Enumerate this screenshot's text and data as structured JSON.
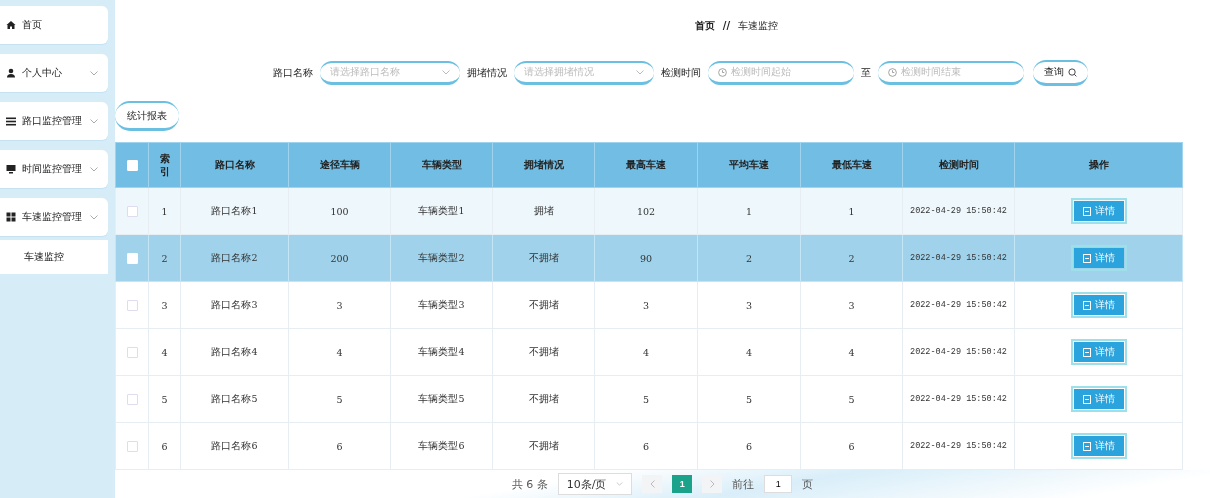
{
  "sidebar": {
    "items": [
      {
        "label": "首页",
        "expandable": false,
        "selected": false
      },
      {
        "label": "个人中心",
        "expandable": true,
        "selected": false
      },
      {
        "label": "路口监控管理",
        "expandable": true,
        "selected": false
      },
      {
        "label": "时间监控管理",
        "expandable": true,
        "selected": false
      },
      {
        "label": "车速监控管理",
        "expandable": true,
        "selected": false,
        "children": [
          {
            "label": "车速监控",
            "selected": true
          }
        ]
      }
    ]
  },
  "breadcrumb": {
    "home": "首页",
    "separator": "//",
    "current": "车速监控"
  },
  "filters": {
    "fields": [
      {
        "kind": "select",
        "label": "路口名称",
        "placeholder": "请选择路口名称"
      },
      {
        "kind": "select",
        "label": "拥堵情况",
        "placeholder": "请选择拥堵情况"
      },
      {
        "kind": "date",
        "label": "检测时间",
        "placeholder": "检测时间起始"
      },
      {
        "kind": "date",
        "label": "至",
        "placeholder": "检测时间结束"
      }
    ],
    "search_button": "查询"
  },
  "report_button": "统计报表",
  "table": {
    "select_all_checked": false,
    "columns": [
      "索引",
      "路口名称",
      "途径车辆",
      "车辆类型",
      "拥堵情况",
      "最高车速",
      "平均车速",
      "最低车速",
      "检测时间",
      "操作"
    ],
    "rows": [
      {
        "selected": false,
        "cells": [
          "1",
          "路口名称1",
          "100",
          "车辆类型1",
          "拥堵",
          "102",
          "1",
          "1",
          "2022-04-29 15:50:42"
        ],
        "action": "详情"
      },
      {
        "selected": true,
        "cells": [
          "2",
          "路口名称2",
          "200",
          "车辆类型2",
          "不拥堵",
          "90",
          "2",
          "2",
          "2022-04-29 15:50:42"
        ],
        "action": "详情"
      },
      {
        "selected": false,
        "cells": [
          "3",
          "路口名称3",
          "3",
          "车辆类型3",
          "不拥堵",
          "3",
          "3",
          "3",
          "2022-04-29 15:50:42"
        ],
        "action": "详情"
      },
      {
        "selected": false,
        "cells": [
          "4",
          "路口名称4",
          "4",
          "车辆类型4",
          "不拥堵",
          "4",
          "4",
          "4",
          "2022-04-29 15:50:42"
        ],
        "action": "详情"
      },
      {
        "selected": false,
        "cells": [
          "5",
          "路口名称5",
          "5",
          "车辆类型5",
          "不拥堵",
          "5",
          "5",
          "5",
          "2022-04-29 15:50:42"
        ],
        "action": "详情"
      },
      {
        "selected": false,
        "cells": [
          "6",
          "路口名称6",
          "6",
          "车辆类型6",
          "不拥堵",
          "6",
          "6",
          "6",
          "2022-04-29 15:50:42"
        ],
        "action": "详情"
      }
    ]
  },
  "pagination": {
    "total": "共 6 条",
    "page_size": "10条/页",
    "pages": [
      {
        "label": "1",
        "selected": true
      }
    ],
    "goto_label": "前往",
    "goto_value": "1",
    "goto_suffix": "页"
  }
}
